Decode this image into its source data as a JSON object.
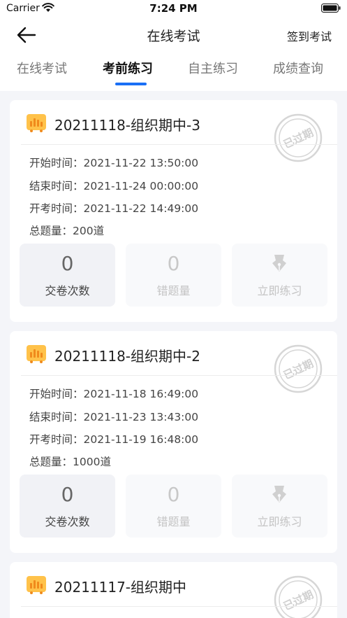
{
  "status_bar": {
    "carrier": "Carrier",
    "time": "7:24 PM"
  },
  "nav": {
    "title": "在线考试",
    "right_action": "签到考试"
  },
  "tabs": [
    {
      "label": "在线考试",
      "active": false
    },
    {
      "label": "考前练习",
      "active": true
    },
    {
      "label": "自主练习",
      "active": false
    },
    {
      "label": "成绩查询",
      "active": false
    }
  ],
  "accent_color": "#1a6ff5",
  "exams": [
    {
      "title": "20211118-组织期中-3",
      "stamp": "已过期",
      "start": "开始时间：2021-11-22 13:50:00",
      "end": "结束时间：2021-11-24 00:00:00",
      "open": "开考时间：2021-11-22 14:49:00",
      "total": "总题量：200道",
      "submit_count": "0",
      "submit_label": "交卷次数",
      "wrong_count": "0",
      "wrong_label": "错题量",
      "practice_label": "立即练习"
    },
    {
      "title": "20211118-组织期中-2",
      "stamp": "已过期",
      "start": "开始时间：2021-11-18 16:49:00",
      "end": "结束时间：2021-11-23 13:43:00",
      "open": "开考时间：2021-11-19 16:48:00",
      "total": "总题量：1000道",
      "submit_count": "0",
      "submit_label": "交卷次数",
      "wrong_count": "0",
      "wrong_label": "错题量",
      "practice_label": "立即练习"
    },
    {
      "title": "20211117-组织期中",
      "stamp": "已过期"
    }
  ]
}
